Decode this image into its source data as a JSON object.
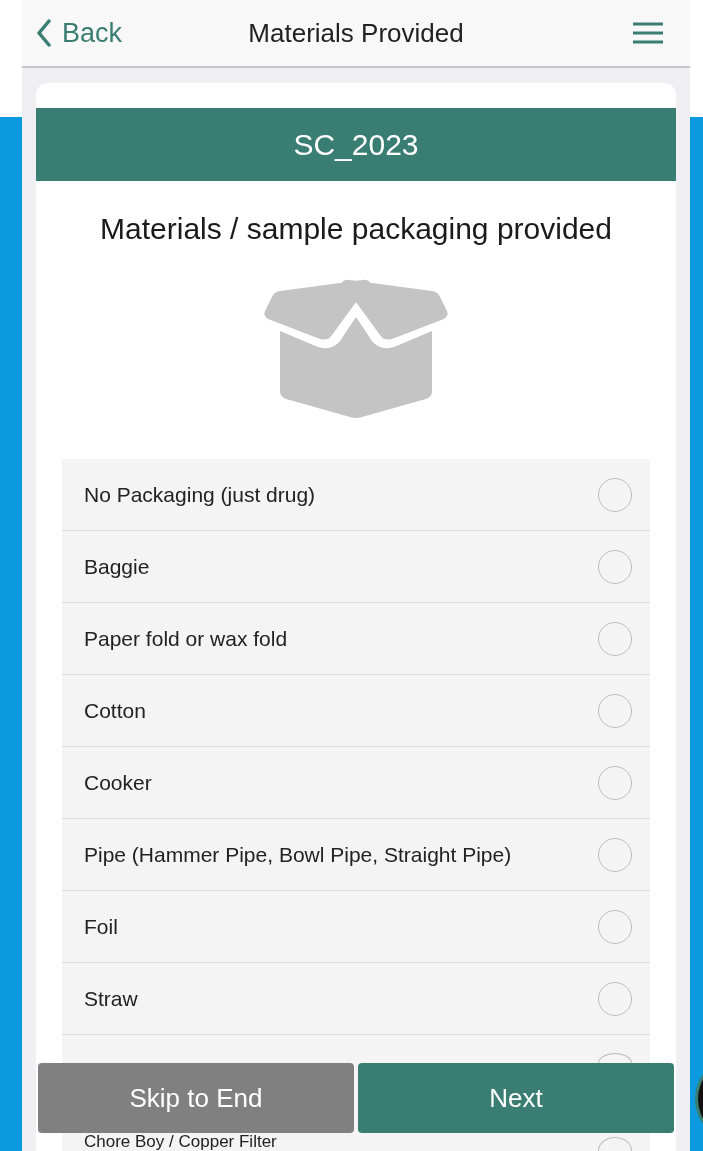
{
  "nav": {
    "back": "Back",
    "title": "Materials Provided"
  },
  "header": "SC_2023",
  "question": "Materials / sample packaging provided",
  "options": [
    {
      "label": "No Packaging (just drug)",
      "selected": false
    },
    {
      "label": "Baggie",
      "selected": false
    },
    {
      "label": "Paper fold or wax fold",
      "selected": false
    },
    {
      "label": "Cotton",
      "selected": false
    },
    {
      "label": "Cooker",
      "selected": false
    },
    {
      "label": "Pipe (Hammer Pipe, Bowl Pipe, Straight Pipe)",
      "selected": false
    },
    {
      "label": "Foil",
      "selected": false
    },
    {
      "label": "Straw",
      "selected": false
    },
    {
      "selected": false
    },
    {
      "label": "Chore Boy / Copper Filter",
      "selected": false
    }
  ],
  "buttons": {
    "skip": "Skip to End",
    "next": "Next"
  }
}
